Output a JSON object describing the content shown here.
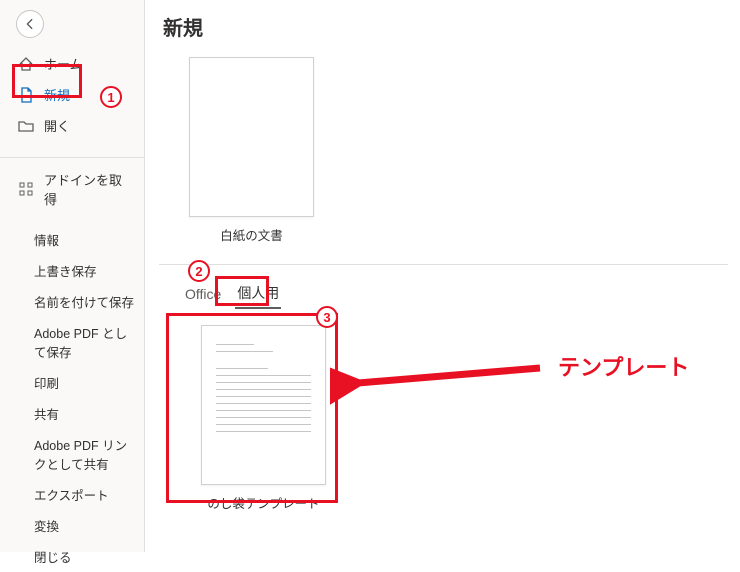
{
  "sidebar": {
    "items": [
      {
        "label": "ホーム",
        "icon": "home"
      },
      {
        "label": "新規",
        "icon": "document",
        "selected": true
      },
      {
        "label": "開く",
        "icon": "folder"
      }
    ],
    "addins_label": "アドインを取得",
    "secondary": [
      {
        "label": "情報"
      },
      {
        "label": "上書き保存"
      },
      {
        "label": "名前を付けて保存"
      },
      {
        "label": "Adobe PDF として保存"
      },
      {
        "label": "印刷"
      },
      {
        "label": "共有"
      },
      {
        "label": "Adobe PDF リンクとして共有"
      },
      {
        "label": "エクスポート"
      },
      {
        "label": "変換"
      },
      {
        "label": "閉じる"
      }
    ]
  },
  "main": {
    "title": "新規",
    "blank_tile_caption": "白紙の文書",
    "tabs": [
      {
        "label": "Office",
        "active": false
      },
      {
        "label": "個人用",
        "active": true
      }
    ],
    "template_caption": "のし袋テンプレート"
  },
  "annotations": {
    "n1": "1",
    "n2": "2",
    "n3": "3",
    "callout": "テンプレート"
  }
}
